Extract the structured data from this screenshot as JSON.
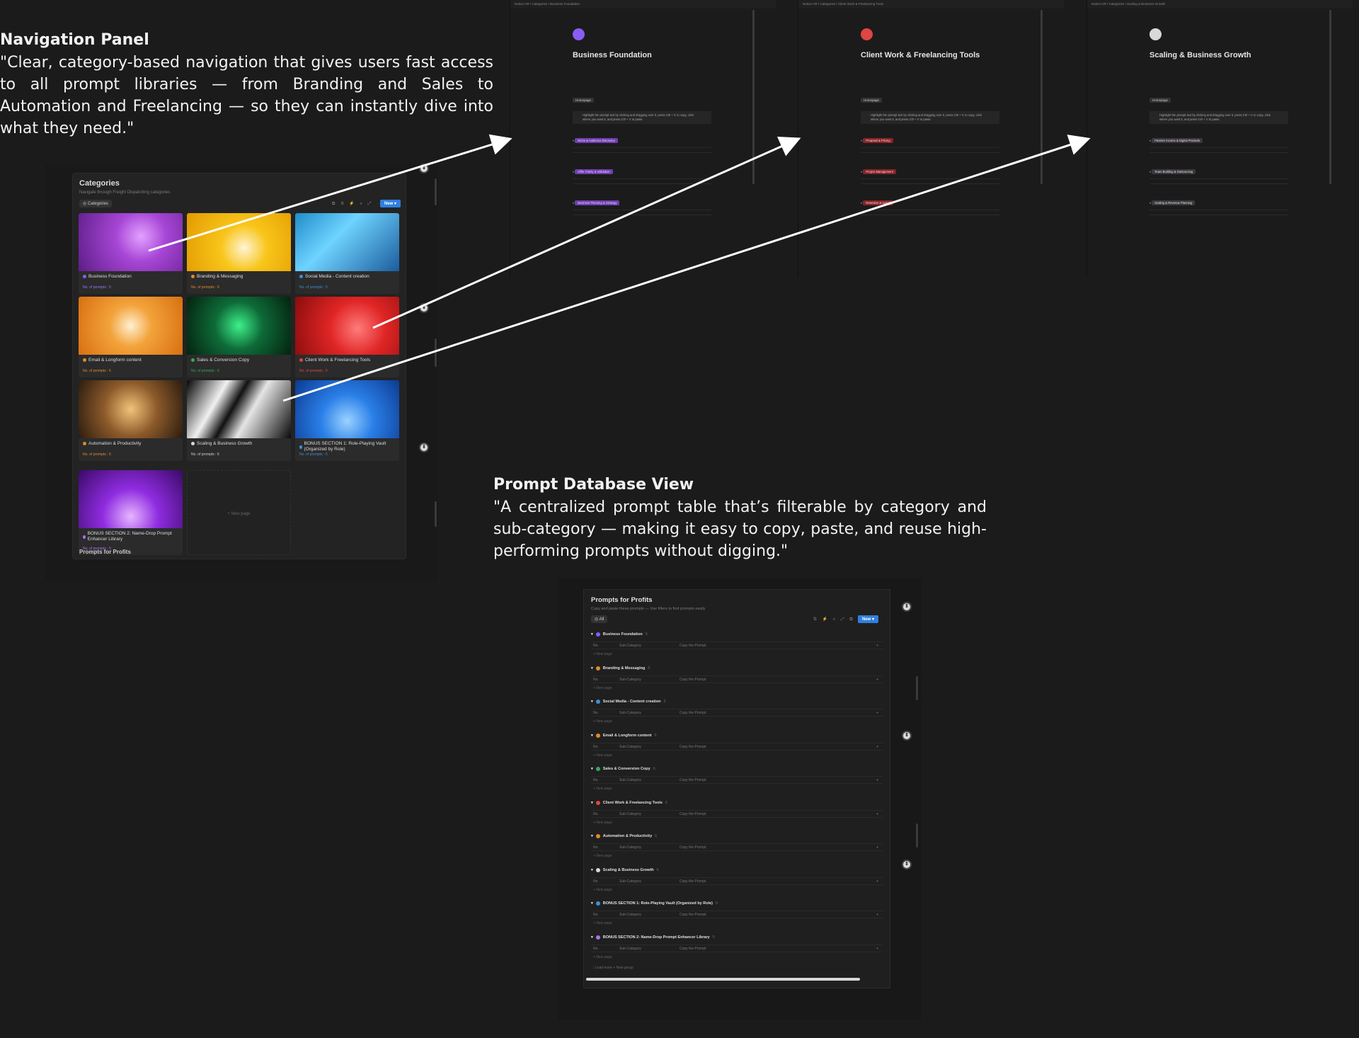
{
  "captions": {
    "nav_heading": "Navigation Panel",
    "nav_text": "\"Clear, category-based navigation that gives users fast access to all prompt libraries — from Branding and Sales to Automation and Freelancing — so they can instantly dive into what they need.\"",
    "db_heading": "Prompt Database View",
    "db_text": " \"A centralized prompt table that’s filterable by category and sub-category — making it easy to copy, paste, and reuse high-performing prompts without digging.\""
  },
  "nav_panel": {
    "title": "Categories",
    "subtitle": "Navigate through Freight Dispatching categories",
    "view_pill": "Categories",
    "new_button": "New",
    "below_title": "Prompts for Profits",
    "new_page": "+ New page",
    "cards": [
      {
        "name": "Business Foundation",
        "count": "No. of prompts : 5",
        "dot": "#8a5cf6",
        "count_color": "#9a7af8"
      },
      {
        "name": "Branding & Messaging",
        "count": "No. of prompts : 6",
        "dot": "#e08a2b",
        "count_color": "#e08a2b"
      },
      {
        "name": "Social Media - Content creation",
        "count": "No. of prompts : 5",
        "dot": "#3d8fd9",
        "count_color": "#3d8fd9"
      },
      {
        "name": "Email & Longform content",
        "count": "No. of prompts : 6",
        "dot": "#e08a2b",
        "count_color": "#e08a2b"
      },
      {
        "name": "Sales & Conversion Copy",
        "count": "No. of prompts : 6",
        "dot": "#37a85c",
        "count_color": "#37a85c"
      },
      {
        "name": "Client Work & Freelancing Tools",
        "count": "No. of prompts : 6",
        "dot": "#e04444",
        "count_color": "#e04444"
      },
      {
        "name": "Automation & Productivity",
        "count": "No. of prompts : 6",
        "dot": "#e08a2b",
        "count_color": "#e08a2b"
      },
      {
        "name": "Scaling & Business Growth",
        "count": "No. of prompts : 6",
        "dot": "#d9d9d9",
        "count_color": "#cfcfcf"
      },
      {
        "name": "BONUS SECTION 1: Role-Playing Vault (Organized by Role)",
        "count": "No. of prompts : 6",
        "dot": "#3d8fd9",
        "count_color": "#3d8fd9"
      },
      {
        "name": "BONUS SECTION 2: Name-Drop Prompt Enhancer Library",
        "count": "No. of prompts : 5",
        "dot": "#b16ff2",
        "count_color": "#b16ff2"
      }
    ]
  },
  "details": [
    {
      "crumb": "Notion HR  /  Categories  /  Business Foundation",
      "title": "Business Foundation",
      "color": "#8a5cf6",
      "tag": "Homepage",
      "callout": "Highlight the prompt text by clicking and dragging over it, press Ctrl + C to copy, click where you want it, and press Ctrl + V to paste.",
      "groups": [
        "Niche & Audience Discovery",
        "Offer Clarity & Validation",
        "Business Planning & Strategy"
      ],
      "group_color": "#6e3fb0"
    },
    {
      "crumb": "Notion HR  /  Categories  /  Client Work & Freelancing Tools",
      "title": "Client Work & Freelancing Tools",
      "color": "#e04444",
      "tag": "Homepage",
      "callout": "Highlight the prompt text by clicking and dragging over it, press Ctrl + C to copy, click where you want it, and press Ctrl + V to paste.",
      "groups": [
        "Proposal & Pricing",
        "Project Management",
        "Retention & Upsell"
      ],
      "group_color": "#8a2424"
    },
    {
      "crumb": "Notion HR  /  Categories  /  Scaling & Business Growth",
      "title": "Scaling & Business Growth",
      "color": "#d9d9d9",
      "tag": "Homepage",
      "callout": "Highlight the prompt text by clicking and dragging over it, press Ctrl + C to copy, click where you want it, and press Ctrl + V to paste.",
      "groups": [
        "Passive Income & Digital Products",
        "Team Building & Outsourcing",
        "Scaling & Revenue Planning"
      ],
      "group_color": "#3a3a3a"
    }
  ],
  "db": {
    "title": "Prompts for Profits",
    "subtitle": "Copy and paste these prompts — Use filters to find prompts easily",
    "filter": "All",
    "new_button": "New",
    "col_no": "No.",
    "col_sub": "Sub-Category",
    "col_copy": "Copy the Prompt",
    "new_page": "+ New page",
    "footer": "↓ Load more    + New group",
    "groups": [
      {
        "name": "Business Foundation",
        "dot": "#8a5cf6",
        "count": "5"
      },
      {
        "name": "Branding & Messaging",
        "dot": "#e08a2b",
        "count": "6"
      },
      {
        "name": "Social Media - Content creation",
        "dot": "#3d8fd9",
        "count": "5"
      },
      {
        "name": "Email & Longform content",
        "dot": "#e08a2b",
        "count": "6"
      },
      {
        "name": "Sales & Conversion Copy",
        "dot": "#37a85c",
        "count": "6"
      },
      {
        "name": "Client Work & Freelancing Tools",
        "dot": "#e04444",
        "count": "6"
      },
      {
        "name": "Automation & Productivity",
        "dot": "#e08a2b",
        "count": "6"
      },
      {
        "name": "Scaling & Business Growth",
        "dot": "#d9d9d9",
        "count": "6"
      },
      {
        "name": "BONUS SECTION 1: Role-Playing Vault (Organized by Role)",
        "dot": "#3d8fd9",
        "count": "6"
      },
      {
        "name": "BONUS SECTION 2: Name-Drop Prompt Enhancer Library",
        "dot": "#b16ff2",
        "count": "5"
      }
    ]
  }
}
